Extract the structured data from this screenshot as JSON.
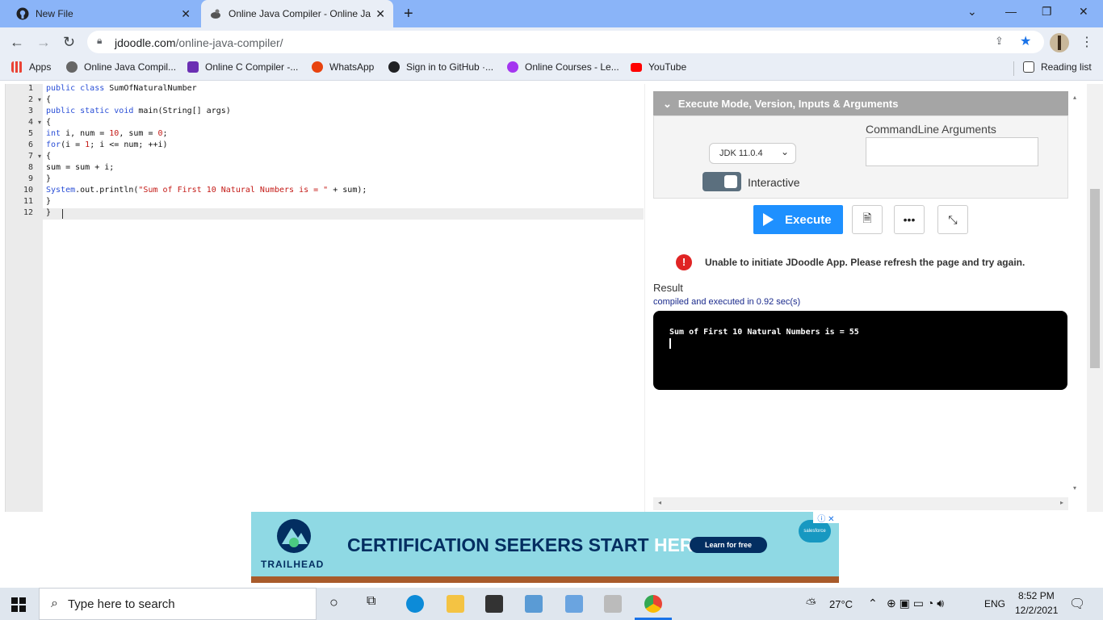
{
  "browser": {
    "tabs": [
      {
        "title": "New File",
        "icon": "github-icon"
      },
      {
        "title": "Online Java Compiler - Online Ja",
        "icon": "jdoodle-icon",
        "active": true
      }
    ],
    "url_host": "jdoodle.com",
    "url_path": "/online-java-compiler/",
    "bookmarks": [
      {
        "label": "Apps",
        "icon": "apps-grid-icon",
        "color": "#4285f4"
      },
      {
        "label": "Online Java Compil...",
        "icon": "jdoodle-icon",
        "color": "#555555"
      },
      {
        "label": "Online C Compiler -...",
        "icon": "lightning-icon",
        "color": "#6b2fb3"
      },
      {
        "label": "WhatsApp",
        "icon": "alert-icon",
        "color": "#e8430f"
      },
      {
        "label": "Sign in to GitHub ·...",
        "icon": "github-icon",
        "color": "#202124"
      },
      {
        "label": "Online Courses - Le...",
        "icon": "udemy-icon",
        "color": "#a435f0"
      },
      {
        "label": "YouTube",
        "icon": "youtube-icon",
        "color": "#ff0000"
      }
    ],
    "reading_list": "Reading list"
  },
  "editor": {
    "line_numbers": [
      "1",
      "2",
      "3",
      "4",
      "5",
      "6",
      "7",
      "8",
      "9",
      "10",
      "11",
      "12"
    ],
    "folds": [
      "2",
      "4",
      "7"
    ],
    "lines": [
      [
        {
          "t": "public class ",
          "c": "kw"
        },
        {
          "t": "SumOfNaturalNumber",
          "c": ""
        }
      ],
      [
        {
          "t": "{",
          "c": ""
        }
      ],
      [
        {
          "t": "public static void ",
          "c": "kw"
        },
        {
          "t": "main(String[] args)",
          "c": ""
        }
      ],
      [
        {
          "t": "{",
          "c": ""
        }
      ],
      [
        {
          "t": "int ",
          "c": "kw"
        },
        {
          "t": "i, num = ",
          "c": ""
        },
        {
          "t": "10",
          "c": "num"
        },
        {
          "t": ", sum = ",
          "c": ""
        },
        {
          "t": "0",
          "c": "num"
        },
        {
          "t": ";",
          "c": ""
        }
      ],
      [
        {
          "t": "for",
          "c": "kw"
        },
        {
          "t": "(i = ",
          "c": ""
        },
        {
          "t": "1",
          "c": "num"
        },
        {
          "t": "; i <= num; ++i)",
          "c": ""
        }
      ],
      [
        {
          "t": "{",
          "c": ""
        }
      ],
      [
        {
          "t": "sum = sum + i;",
          "c": ""
        }
      ],
      [
        {
          "t": "}",
          "c": ""
        }
      ],
      [
        {
          "t": "System",
          "c": "kw"
        },
        {
          "t": ".out.println(",
          "c": ""
        },
        {
          "t": "\"Sum of First 10 Natural Numbers is = \"",
          "c": "str"
        },
        {
          "t": " + sum);",
          "c": ""
        }
      ],
      [
        {
          "t": "}",
          "c": ""
        }
      ],
      [
        {
          "t": "}",
          "c": ""
        }
      ]
    ]
  },
  "panel": {
    "section_title": "Execute Mode, Version, Inputs & Arguments",
    "jdk_version": "JDK 11.0.4",
    "interactive_label": "Interactive",
    "interactive_on": true,
    "cmdline_label": "CommandLine Arguments",
    "cmdline_value": "",
    "execute_label": "Execute",
    "error_message": "Unable to initiate JDoodle App. Please refresh the page and try again.",
    "result_label": "Result",
    "compiled_text": "compiled and executed in 0.92 sec(s)",
    "output": "Sum of First 10 Natural Numbers is = 55"
  },
  "ad": {
    "brand": "TRAILHEAD",
    "headline_start": "CERTIFICATION SEEKERS START ",
    "headline_end": "HERE.",
    "cta": "Learn for free",
    "partner": "salesforce"
  },
  "taskbar": {
    "search_placeholder": "Type here to search",
    "temperature": "27°C",
    "language": "ENG",
    "time": "8:52 PM",
    "date": "12/2/2021"
  }
}
